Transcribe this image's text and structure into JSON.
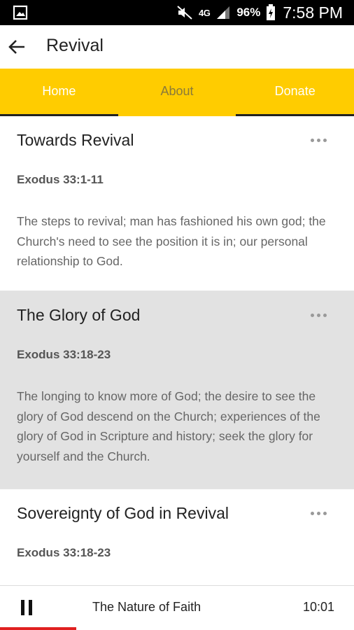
{
  "status_bar": {
    "network": "4G",
    "battery": "96%",
    "time": "7:58 PM",
    "icons": [
      "image-icon",
      "mute-icon",
      "signal-icon",
      "battery-icon"
    ]
  },
  "app_bar": {
    "title": "Revival",
    "back_icon": "arrow-left-icon"
  },
  "tabs": [
    {
      "label": "Home",
      "active": false
    },
    {
      "label": "About",
      "active": true
    },
    {
      "label": "Donate",
      "active": false
    }
  ],
  "sermons": [
    {
      "title": "Towards Revival",
      "reference": "Exodus 33:1-11",
      "description": "The steps to revival; man has fashioned his own god; the Church's need to see the position it is in; our personal relationship to God."
    },
    {
      "title": "The Glory of God",
      "reference": "Exodus 33:18-23",
      "description": "The longing to know more of God; the desire to see the glory of God descend on the Church; experiences of the glory of God in Scripture and history; seek the glory for yourself and the Church."
    },
    {
      "title": "Sovereignty of God in Revival",
      "reference": "Exodus 33:18-23",
      "description": ""
    }
  ],
  "player": {
    "title": "The Nature of Faith",
    "time": "10:01",
    "progress": 0.215
  },
  "colors": {
    "accent": "#ffcc00",
    "highlight_row": "#e2e2e2",
    "progress": "#e02020"
  }
}
